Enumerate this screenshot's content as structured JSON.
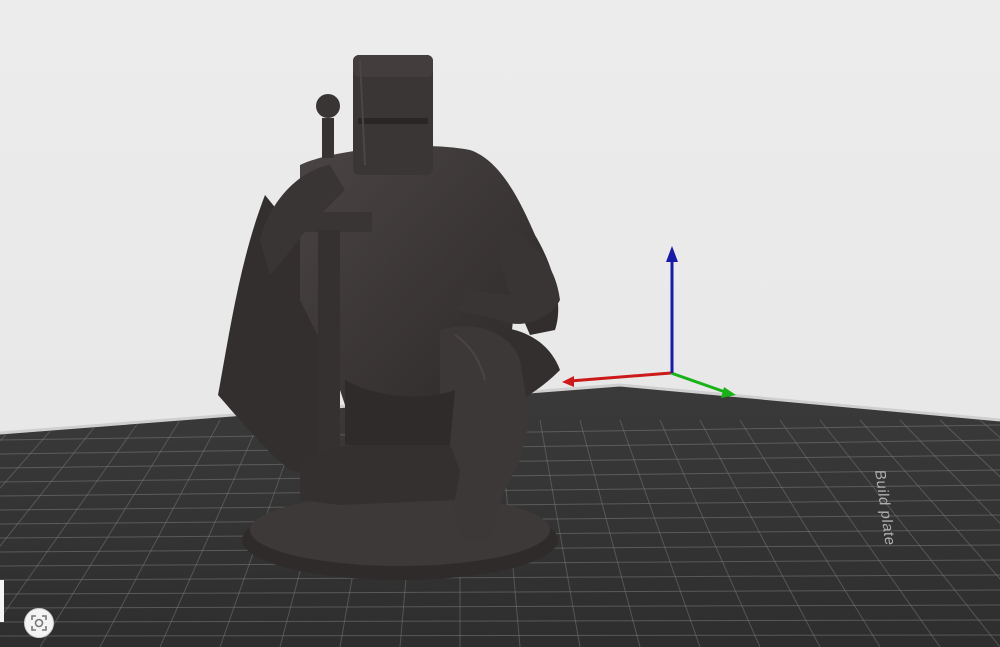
{
  "viewport": {
    "background_color": "#e9e9e9",
    "plate_color": "#333333",
    "grid_color": "#7a7a7a",
    "model_color": "#3d3838"
  },
  "build_plate": {
    "label": "Build plate"
  },
  "axes": {
    "x_color": "#cc1a1a",
    "y_color": "#19b319",
    "z_color": "#1a1aa8"
  },
  "controls": {
    "reset_view_icon": "camera-reset-icon"
  }
}
